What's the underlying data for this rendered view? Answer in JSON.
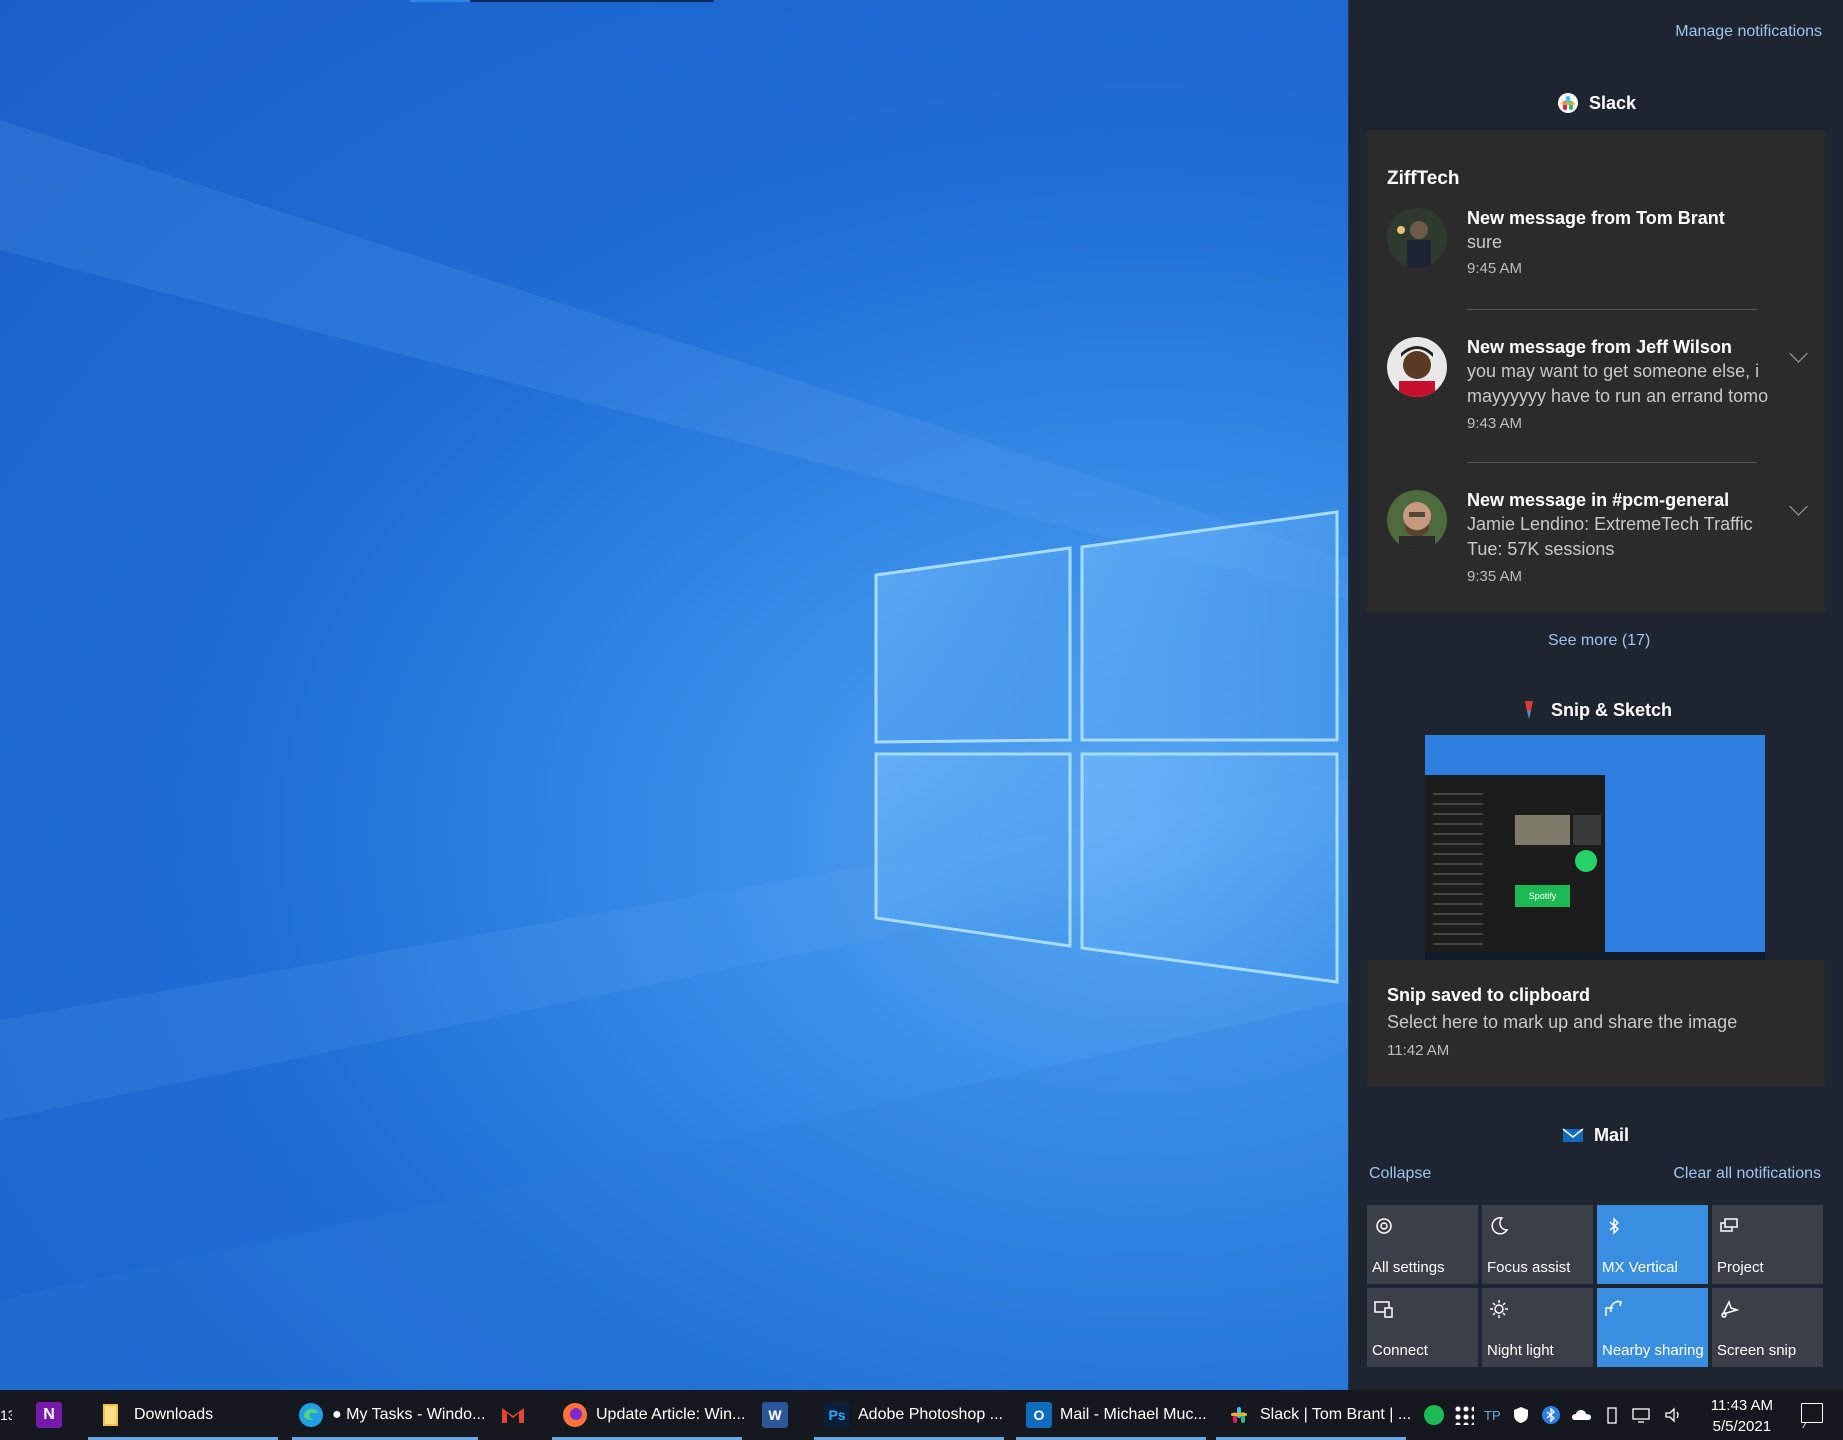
{
  "action_center": {
    "manage_notifications": "Manage notifications",
    "slack": {
      "app_name": "Slack",
      "workspace": "ZiffTech",
      "notifications": [
        {
          "title": "New message from Tom Brant",
          "body_line1": "sure",
          "body_line2": "",
          "time": "9:45 AM"
        },
        {
          "title": "New message from Jeff Wilson",
          "body_line1": "you may want to get someone else, i",
          "body_line2": "mayyyyyy have to run an errand tomo",
          "time": "9:43 AM"
        },
        {
          "title": "New message in #pcm-general",
          "body_line1": "Jamie Lendino: ExtremeTech Traffic",
          "body_line2": "Tue: 57K sessions",
          "time": "9:35 AM"
        }
      ],
      "see_more": "See more (17)"
    },
    "snip": {
      "app_name": "Snip & Sketch",
      "title": "Snip saved to clipboard",
      "body": "Select here to mark up and share the image",
      "time": "11:42 AM",
      "thumb_label": "Spotify"
    },
    "mail": {
      "app_name": "Mail"
    },
    "collapse": "Collapse",
    "clear_all": "Clear all notifications",
    "quick_actions": [
      {
        "label": "All settings",
        "icon": "gear-icon",
        "on": false
      },
      {
        "label": "Focus assist",
        "icon": "moon-icon",
        "on": false
      },
      {
        "label": "MX Vertical",
        "icon": "bluetooth-icon",
        "on": true
      },
      {
        "label": "Project",
        "icon": "project-icon",
        "on": false
      },
      {
        "label": "Connect",
        "icon": "connect-icon",
        "on": false
      },
      {
        "label": "Night light",
        "icon": "sun-icon",
        "on": false
      },
      {
        "label": "Nearby sharing",
        "icon": "share-icon",
        "on": true
      },
      {
        "label": "Screen snip",
        "icon": "snip-icon",
        "on": false
      }
    ]
  },
  "taskbar": {
    "partial_label": "13",
    "items": [
      {
        "label": "",
        "icon": "onenote-icon",
        "color": "#7719aa"
      },
      {
        "label": "Downloads",
        "icon": "folder-icon",
        "color": "#f3c23c"
      },
      {
        "label": "● My Tasks - Windo...",
        "icon": "edge-icon",
        "color": "#1fa0e6"
      },
      {
        "label": "",
        "icon": "gmail-icon",
        "color": "#ea4335"
      },
      {
        "label": "Update Article: Win...",
        "icon": "firefox-icon",
        "color": "#ff7139"
      },
      {
        "label": "",
        "icon": "word-icon",
        "color": "#2b579a"
      },
      {
        "label": "Adobe Photoshop ...",
        "icon": "photoshop-icon",
        "color": "#0b1f3a"
      },
      {
        "label": "Mail - Michael Muc...",
        "icon": "outlook-icon",
        "color": "#0f6cbd"
      },
      {
        "label": "Slack | Tom Brant | ...",
        "icon": "slack-icon",
        "color": "#4a154b"
      }
    ],
    "tray_text": "TP",
    "time": "11:43 AM",
    "date": "5/5/2021"
  },
  "colors": {
    "accent": "#3a8ee0",
    "panel": "#1f2530",
    "card": "#2b2b2b",
    "link": "#9ec5ef"
  }
}
